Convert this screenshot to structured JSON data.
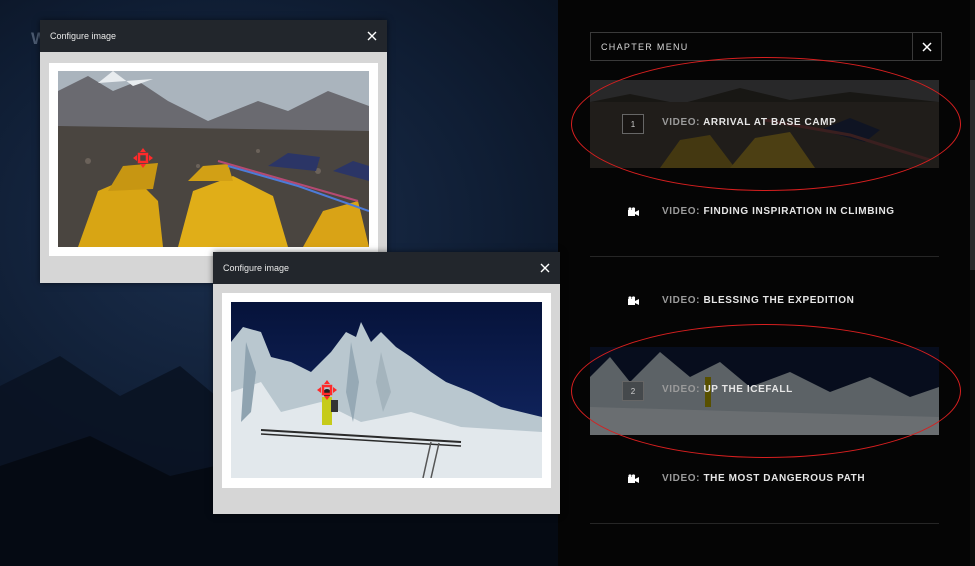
{
  "background": {
    "heading_fragment": "W"
  },
  "chapter_menu": {
    "title": "CHAPTER MENU",
    "close_icon": "close-icon",
    "items": [
      {
        "number": "1",
        "prefix": "VIDEO:",
        "label": "ARRIVAL AT BASE CAMP",
        "has_thumbnail": true,
        "highlighted": true
      },
      {
        "icon": "video-camera-icon",
        "prefix": "VIDEO:",
        "label": "FINDING INSPIRATION IN CLIMBING",
        "has_thumbnail": false
      },
      {
        "icon": "video-camera-icon",
        "prefix": "VIDEO:",
        "label": "BLESSING THE EXPEDITION",
        "has_thumbnail": false
      },
      {
        "number": "2",
        "prefix": "VIDEO:",
        "label": "UP THE ICEFALL",
        "has_thumbnail": true,
        "highlighted": true
      },
      {
        "icon": "video-camera-icon",
        "prefix": "VIDEO:",
        "label": "THE MOST DANGEROUS PATH",
        "has_thumbnail": false
      }
    ]
  },
  "dialogs": [
    {
      "title": "Configure image",
      "close_icon": "close-icon",
      "image": "base-camp-tents-photo",
      "focal_point_icon": "focal-point-icon"
    },
    {
      "title": "Configure image",
      "close_icon": "close-icon",
      "image": "icefall-ladder-climber-photo",
      "focal_point_icon": "focal-point-icon"
    }
  ],
  "colors": {
    "sidebar_bg": "#050505",
    "dialog_header": "#22262c",
    "annotation_red": "#d61f1f",
    "focal_red": "#ff2a2a",
    "label_prefix": "#9b9b9b"
  }
}
